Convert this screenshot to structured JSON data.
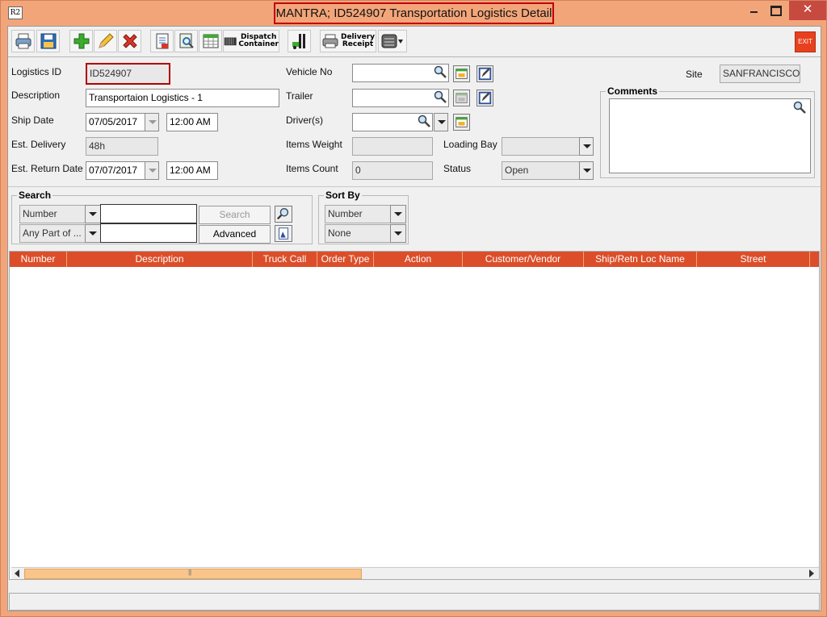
{
  "window": {
    "title": "MANTRA; ID524907 Transportation Logistics Detail",
    "app_icon_text": "R2",
    "close_glyph": "✕"
  },
  "toolbar": {
    "dispatch_line1": "Dispatch",
    "dispatch_line2": "Container",
    "delivery_line1": "Delivery",
    "delivery_line2": "Receipt",
    "exit_label": "EXIT"
  },
  "form": {
    "logistics_id_label": "Logistics ID",
    "logistics_id_value": "ID524907",
    "description_label": "Description",
    "description_value": "Transportaion Logistics - 1",
    "ship_date_label": "Ship Date",
    "ship_date_value": "07/05/2017",
    "ship_time_value": "12:00 AM",
    "est_delivery_label": "Est. Delivery",
    "est_delivery_value": "48h",
    "est_return_label": "Est. Return Date",
    "est_return_value": "07/07/2017",
    "return_time_value": "12:00 AM",
    "vehicle_no_label": "Vehicle No",
    "vehicle_no_value": "",
    "trailer_label": "Trailer",
    "trailer_value": "",
    "drivers_label": "Driver(s)",
    "drivers_value": "",
    "items_weight_label": "Items Weight",
    "items_weight_value": "",
    "items_count_label": "Items Count",
    "items_count_value": "0",
    "loading_bay_label": "Loading Bay",
    "loading_bay_value": "",
    "status_label": "Status",
    "status_value": "Open",
    "site_label": "Site",
    "site_value": "SANFRANCISCO",
    "comments_label": "Comments",
    "comments_value": ""
  },
  "search": {
    "title": "Search",
    "field_select": "Number",
    "match_select": "Any Part of ...",
    "search_button": "Search",
    "advanced_button": "Advanced",
    "query1": "",
    "query2": ""
  },
  "sort": {
    "title": "Sort By",
    "primary": "Number",
    "secondary": "None"
  },
  "grid": {
    "columns": [
      "Number",
      "Description",
      "Truck Call",
      "Order Type",
      "Action",
      "Customer/Vendor",
      "Ship/Retn Loc Name",
      "Street"
    ],
    "rows": []
  },
  "colors": {
    "frame": "#f3a57a",
    "header": "#dc4e2a",
    "highlight": "#c0000a"
  }
}
